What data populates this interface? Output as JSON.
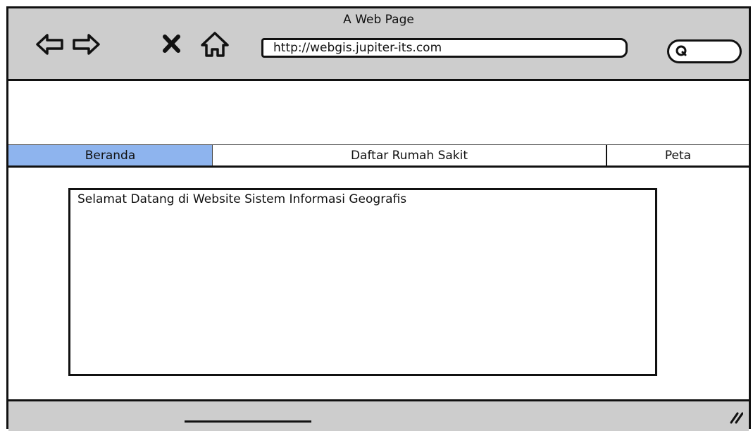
{
  "window": {
    "title": "A Web Page"
  },
  "toolbar": {
    "icons": [
      "back-arrow-icon",
      "forward-arrow-icon",
      "close-icon",
      "home-icon",
      "search-icon"
    ],
    "url_value": "http://webgis.jupiter-its.com",
    "search_value": ""
  },
  "tabs": [
    {
      "label": "Beranda",
      "selected": true
    },
    {
      "label": "Daftar Rumah Sakit",
      "selected": false
    },
    {
      "label": "Peta",
      "selected": false
    }
  ],
  "main": {
    "welcome_text": "Selamat Datang di Website Sistem Informasi Geografis"
  },
  "colors": {
    "chrome_gray": "#cdcdcd",
    "active_tab": "#8eb4ee",
    "stroke": "#111111"
  }
}
